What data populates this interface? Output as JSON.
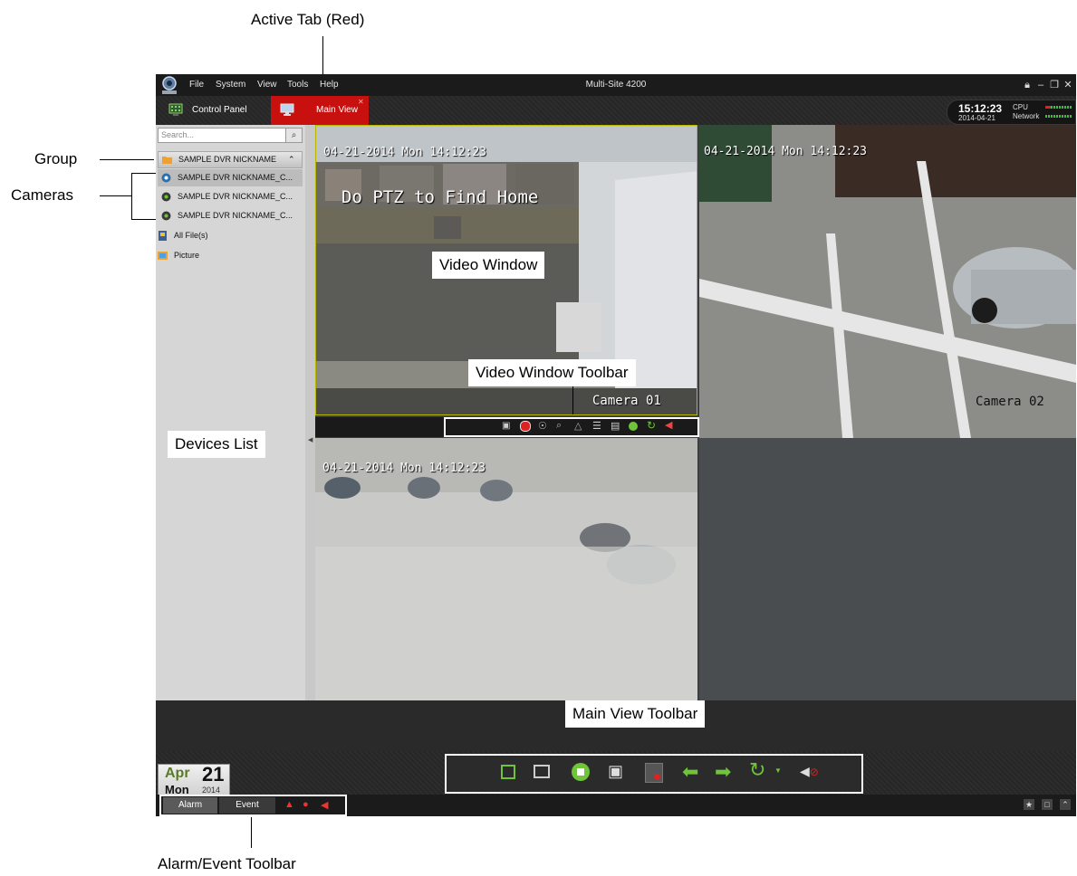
{
  "callouts": {
    "active_tab": "Active Tab (Red)",
    "group": "Group",
    "cameras": "Cameras",
    "devices_list": "Devices List",
    "video_window": "Video Window",
    "video_window_toolbar": "Video Window Toolbar",
    "main_view_toolbar": "Main View Toolbar",
    "alarm_event_toolbar": "Alarm/Event Toolbar"
  },
  "menubar": {
    "items": [
      "File",
      "System",
      "View",
      "Tools",
      "Help"
    ],
    "title": "Multi-Site 4200"
  },
  "tabs": {
    "control_panel": "Control Panel",
    "main_view": "Main View",
    "active_color": "#c8110f"
  },
  "status": {
    "time": "15:12:23",
    "date": "2014-04-21",
    "cpu_label": "CPU",
    "network_label": "Network"
  },
  "sidebar": {
    "search_placeholder": "Search...",
    "group_label": "SAMPLE DVR NICKNAME",
    "cameras": [
      "SAMPLE DVR NICKNAME_C...",
      "SAMPLE DVR NICKNAME_C...",
      "SAMPLE DVR NICKNAME_C..."
    ],
    "all_files": "All File(s)",
    "picture": "Picture"
  },
  "video": {
    "cam1": {
      "timestamp": "04-21-2014 Mon 14:12:23",
      "overlay": "Do PTZ to Find Home",
      "name": "Camera 01"
    },
    "cam2": {
      "timestamp": "04-21-2014 Mon 14:12:23",
      "name": "Camera 02"
    },
    "cam3": {
      "timestamp": "04-21-2014 Mon 14:12:23"
    }
  },
  "date_widget": {
    "month": "Apr",
    "day": "21",
    "weekday": "Mon",
    "year": "2014"
  },
  "alarm_event": {
    "alarm": "Alarm",
    "event": "Event"
  },
  "colors": {
    "accent_green": "#6fc43a",
    "tab_red": "#c8110f",
    "selection_border": "#b8b800"
  }
}
